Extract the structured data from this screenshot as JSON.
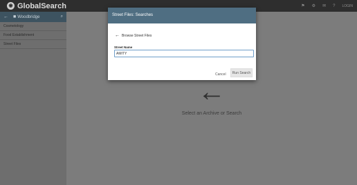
{
  "app": {
    "name": "GlobalSearch"
  },
  "topbar": {
    "login_label": "LOGIN"
  },
  "sidebar": {
    "header_title": "Woodbridge",
    "items": [
      {
        "label": "Cosmetology"
      },
      {
        "label": "Food Establishment"
      },
      {
        "label": "Street Files"
      }
    ]
  },
  "main": {
    "empty_message": "Select an Archive or Search"
  },
  "modal": {
    "title": "Street Files: Searches",
    "browse_label": "Browse Street Files",
    "field_label": "Street Name",
    "field_value": "AMITY",
    "cancel_label": "Cancel",
    "run_label": "Run Search"
  }
}
